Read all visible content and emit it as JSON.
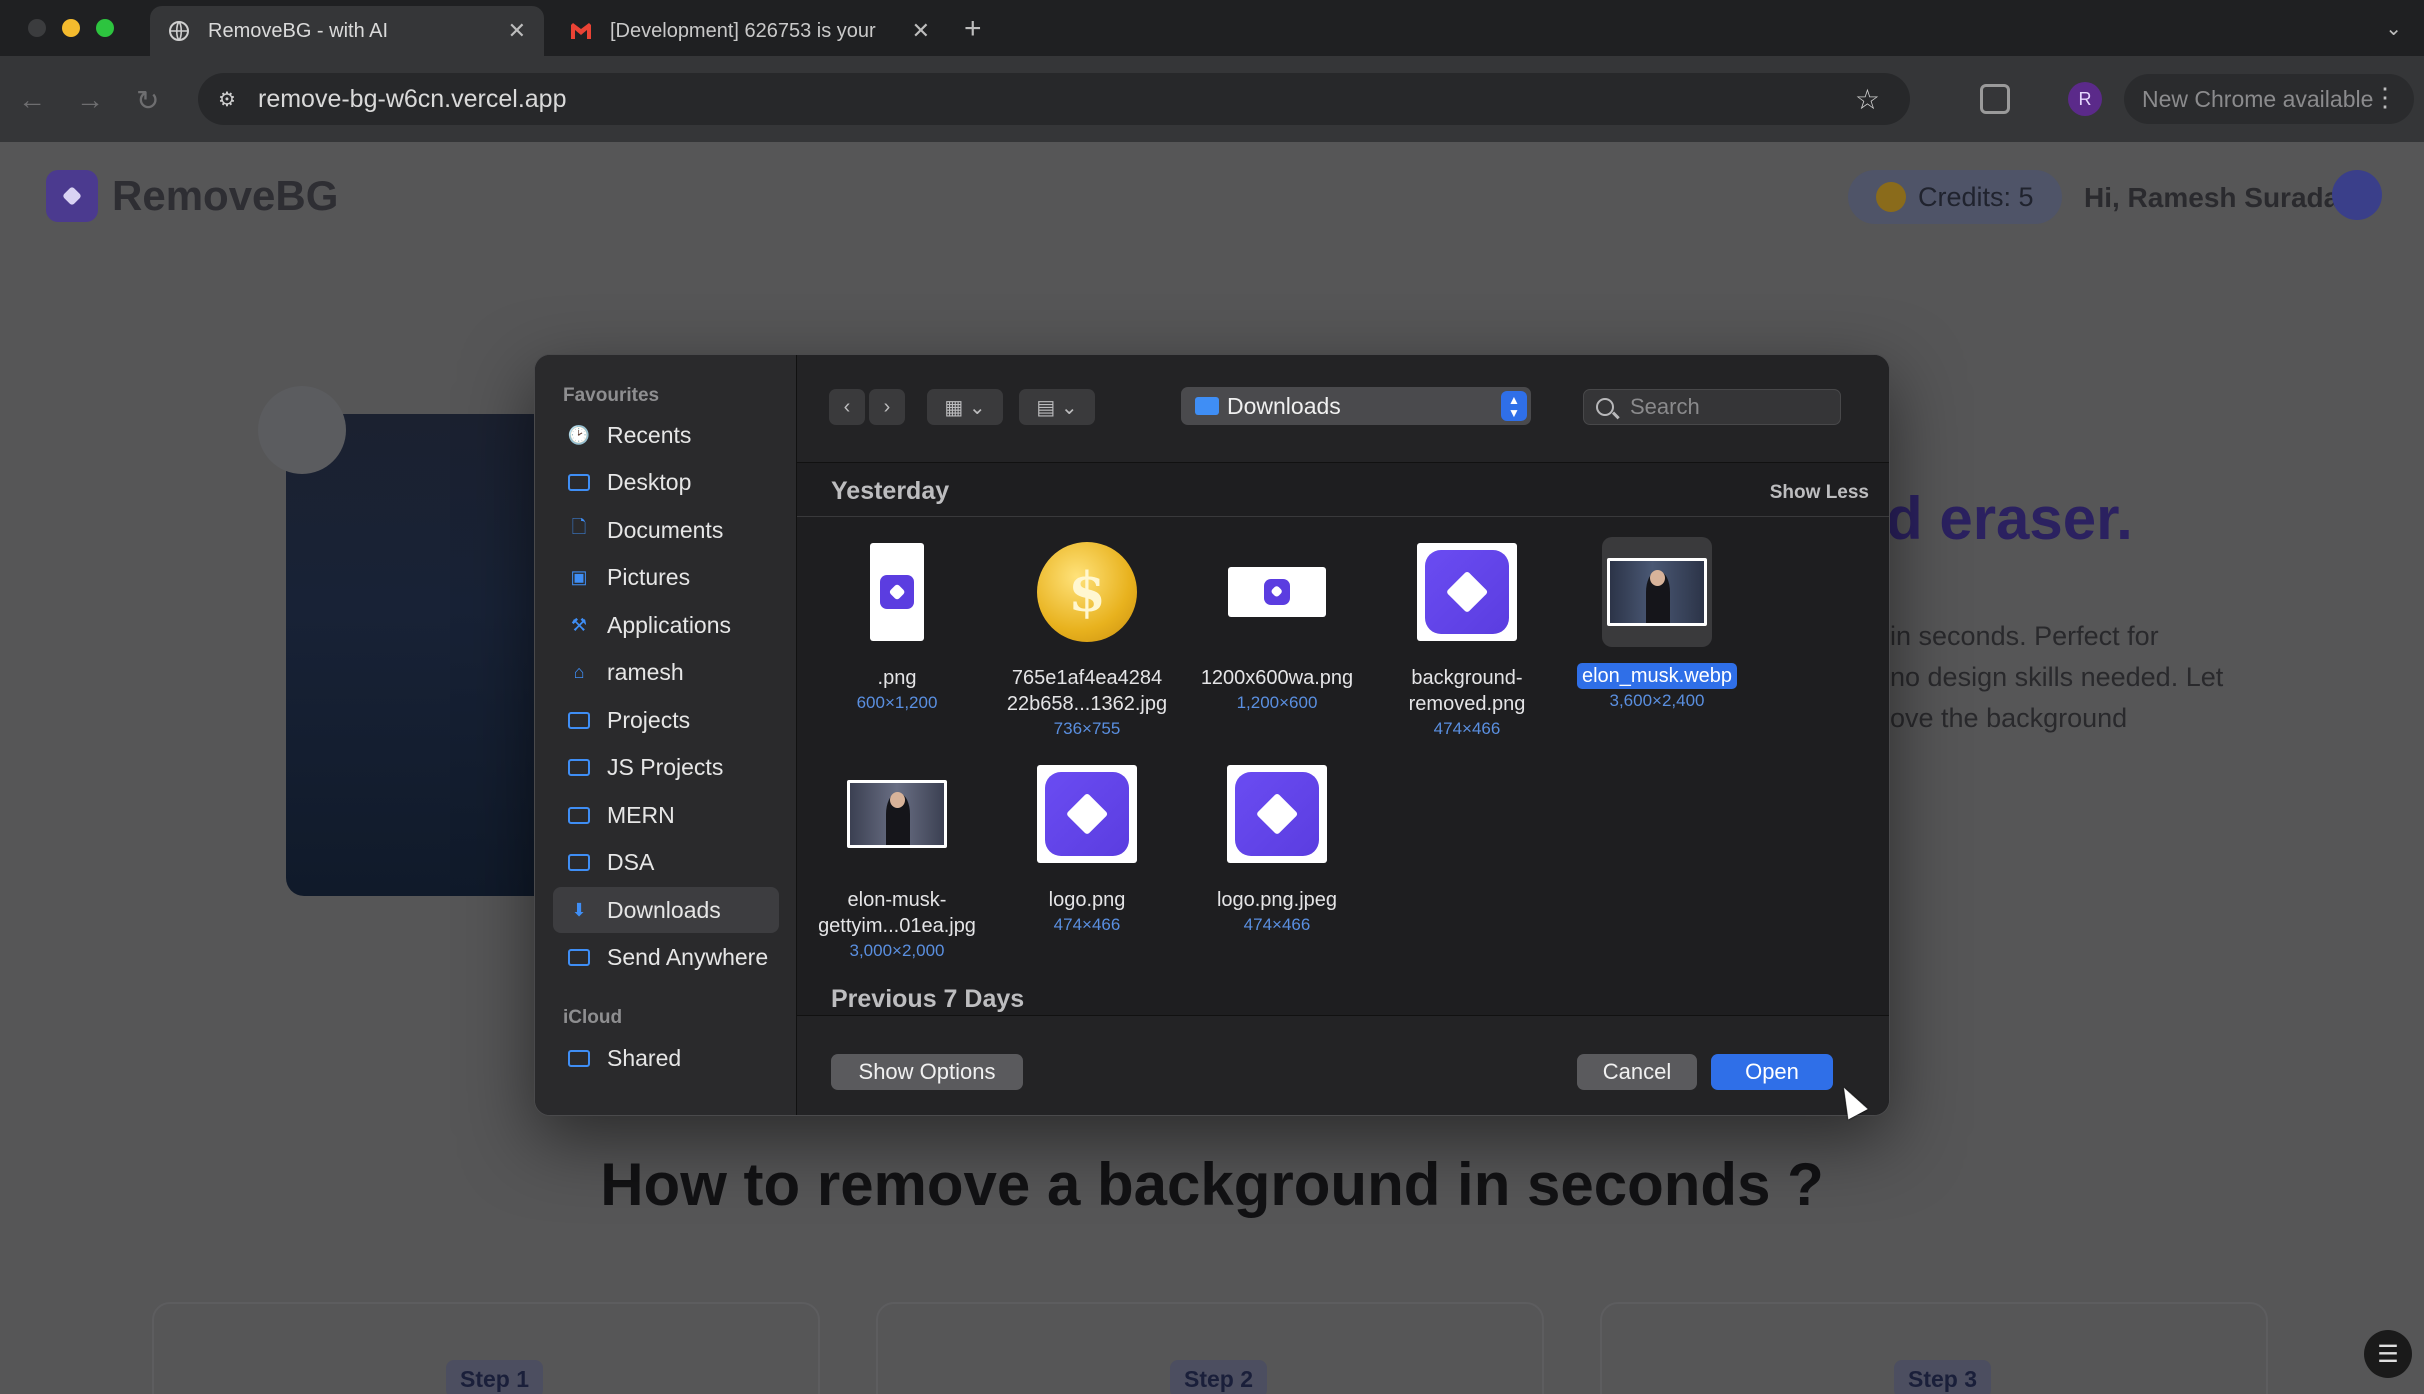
{
  "browser": {
    "tabs": [
      {
        "title": "RemoveBG - with AI",
        "active": true
      },
      {
        "title": "[Development] 626753 is your",
        "active": false
      }
    ],
    "new_tab": "+",
    "url": "remove-bg-w6cn.vercel.app",
    "profile_initial": "R",
    "update_label": "New Chrome available"
  },
  "page": {
    "logo_text": "RemoveBG",
    "credits_label": "Credits: 5",
    "greeting": "Hi, Ramesh Surada",
    "hero_title_visible": "d eraser.",
    "hero_desc_lines": [
      "in seconds. Perfect for",
      "no design skills needed. Let",
      "ove the background"
    ],
    "how_title": "How to remove a background in seconds ?",
    "steps": [
      "Step 1",
      "Step 2",
      "Step 3"
    ]
  },
  "dialog": {
    "sidebar": {
      "favourites_label": "Favourites",
      "items": [
        {
          "label": "Recents",
          "icon": "clock-icon"
        },
        {
          "label": "Desktop",
          "icon": "desktop-icon"
        },
        {
          "label": "Documents",
          "icon": "document-icon"
        },
        {
          "label": "Pictures",
          "icon": "photo-icon"
        },
        {
          "label": "Applications",
          "icon": "applications-icon"
        },
        {
          "label": "ramesh",
          "icon": "home-icon"
        },
        {
          "label": "Projects",
          "icon": "folder-icon"
        },
        {
          "label": "JS Projects",
          "icon": "folder-icon"
        },
        {
          "label": "MERN",
          "icon": "folder-icon"
        },
        {
          "label": "DSA",
          "icon": "folder-icon"
        },
        {
          "label": "Downloads",
          "icon": "download-icon",
          "selected": true
        },
        {
          "label": "Send Anywhere",
          "icon": "folder-icon"
        }
      ],
      "icloud_label": "iCloud",
      "icloud_items": [
        {
          "label": "Shared",
          "icon": "shared-folder-icon"
        }
      ]
    },
    "location": "Downloads",
    "search_placeholder": "Search",
    "groups": [
      {
        "title": "Yesterday",
        "action": "Show Less"
      },
      {
        "title": "Previous 7 Days"
      }
    ],
    "files": [
      {
        "name": ".png",
        "dims": "600×1,200",
        "thumb": "tall-doc"
      },
      {
        "name": "765e1af4ea4284 22b658...1362.jpg",
        "dims": "736×755",
        "thumb": "coin"
      },
      {
        "name": "1200x600wa.png",
        "dims": "1,200×600",
        "thumb": "wide-doc"
      },
      {
        "name": "background- removed.png",
        "dims": "474×466",
        "thumb": "brand"
      },
      {
        "name": "elon_musk.webp",
        "dims": "3,600×2,400",
        "thumb": "photo",
        "selected": true
      },
      {
        "name": "elon-musk- gettyim...01ea.jpg",
        "dims": "3,000×2,000",
        "thumb": "photo"
      },
      {
        "name": "logo.png",
        "dims": "474×466",
        "thumb": "brand"
      },
      {
        "name": "logo.png.jpeg",
        "dims": "474×466",
        "thumb": "brand-framed"
      }
    ],
    "footer": {
      "show_options": "Show Options",
      "cancel": "Cancel",
      "open": "Open"
    }
  },
  "colors": {
    "accent": "#2f6fe8",
    "brand": "#5b3de0",
    "dialog_bg": "#1e1e20"
  }
}
